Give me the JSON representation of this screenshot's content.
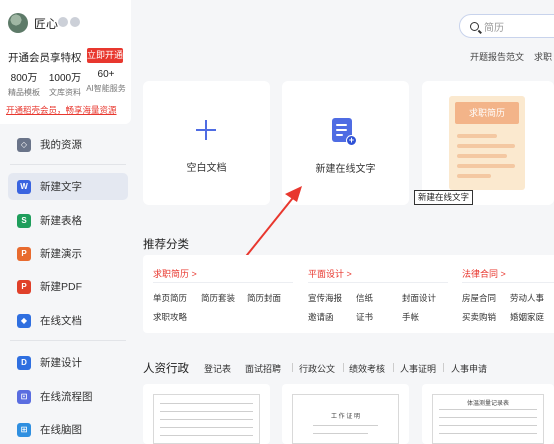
{
  "user": {
    "name": "匠心",
    "member_title": "开通会员享特权",
    "open_button": "立即开通",
    "stats": [
      {
        "value": "800万",
        "label": "精品模板"
      },
      {
        "value": "1000万",
        "label": "文库资料"
      },
      {
        "value": "60+",
        "label": "AI智能服务"
      }
    ],
    "promo": "开通稻壳会员，畅享海量资源"
  },
  "sidebar": {
    "items": [
      {
        "label": "我的资源",
        "icon": "resource-icon",
        "color": "#6a7489"
      },
      {
        "label": "新建文字",
        "icon": "word-icon",
        "color": "#3a64e0"
      },
      {
        "label": "新建表格",
        "icon": "sheet-icon",
        "color": "#1f9e5c"
      },
      {
        "label": "新建演示",
        "icon": "presentation-icon",
        "color": "#e86b2f"
      },
      {
        "label": "新建PDF",
        "icon": "pdf-icon",
        "color": "#e0402a"
      },
      {
        "label": "在线文档",
        "icon": "online-doc-icon",
        "color": "#2f6fe0"
      },
      {
        "label": "新建设计",
        "icon": "design-icon",
        "color": "#2f6fe0"
      },
      {
        "label": "在线流程图",
        "icon": "flowchart-icon",
        "color": "#5a6de0"
      },
      {
        "label": "在线脑图",
        "icon": "mindmap-icon",
        "color": "#2f8fe0"
      }
    ]
  },
  "search": {
    "placeholder": "简历"
  },
  "top_links": [
    "开题报告范文",
    "求职"
  ],
  "cards": {
    "blank": "空白文档",
    "online": "新建在线文字",
    "resume_badge": "求职简历",
    "tooltip": "新建在线文字"
  },
  "recommend": {
    "title": "推荐分类",
    "groups": [
      {
        "head": "求职简历 >",
        "items": [
          "单页简历",
          "简历套装",
          "简历封面",
          "求职攻略"
        ]
      },
      {
        "head": "平面设计 >",
        "items": [
          "宣传海报",
          "信纸",
          "封面设计",
          "邀请函",
          "证书",
          "手帐"
        ]
      },
      {
        "head": "法律合同 >",
        "items": [
          "房屋合同",
          "劳动人事",
          "买卖购销",
          "婚姻家庭"
        ]
      }
    ]
  },
  "hr": {
    "title": "人资行政",
    "tabs": [
      "登记表",
      "面试招聘",
      "行政公文",
      "绩效考核",
      "人事证明",
      "人事申请"
    ],
    "templates": [
      "",
      "工 作 证 明",
      "体温测量记录表"
    ]
  },
  "colors": {
    "accent": "#4f6ce3",
    "red": "#e8372e"
  }
}
